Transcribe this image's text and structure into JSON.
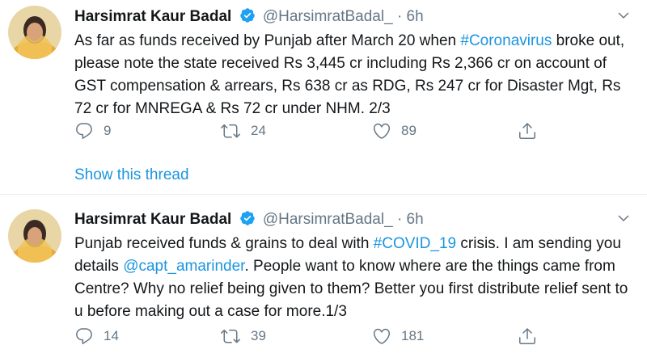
{
  "tweets": [
    {
      "author_name": "Harsimrat Kaur Badal",
      "handle": "@HarsimratBadal_",
      "separator": "·",
      "time": "6h",
      "text_parts": [
        "As far as funds received by Punjab after March 20 when ",
        "#Coronavirus",
        " broke out, please note the state received Rs 3,445 cr including Rs 2,366 cr on account of GST compensation & arrears, Rs 638 cr as RDG, Rs 247 cr for Disaster Mgt, Rs 72 cr for MNREGA & Rs 72 cr under NHM. 2/3"
      ],
      "replies": "9",
      "retweets": "24",
      "likes": "89",
      "show_thread": "Show this thread"
    },
    {
      "author_name": "Harsimrat Kaur Badal",
      "handle": "@HarsimratBadal_",
      "separator": "·",
      "time": "6h",
      "text_parts": [
        "Punjab received funds & grains to deal with ",
        "#COVID_19",
        " crisis. I am sending you details ",
        "@capt_amarinder",
        ". People want to know where are the things came from Centre? Why no relief being given to them? Better you first distribute relief sent to u before making out a case for more.1/3"
      ],
      "replies": "14",
      "retweets": "39",
      "likes": "181"
    }
  ],
  "colors": {
    "accent": "#1b95e0",
    "muted": "#657786",
    "text": "#14171a",
    "divider": "#e6ecf0"
  },
  "icons": [
    "verified-badge-icon",
    "chevron-down-icon",
    "reply-icon",
    "retweet-icon",
    "like-icon",
    "share-icon"
  ]
}
